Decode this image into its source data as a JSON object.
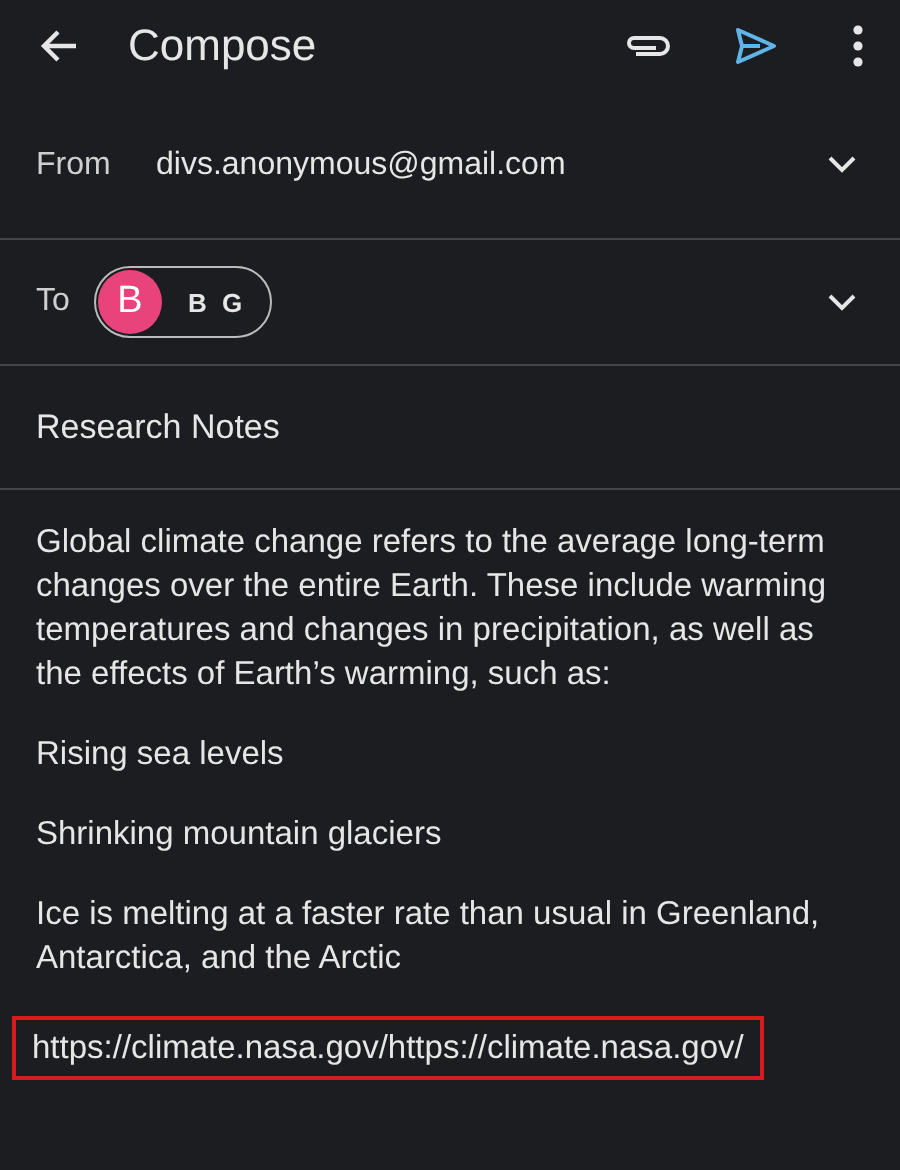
{
  "app_bar": {
    "title": "Compose"
  },
  "from": {
    "label": "From",
    "value": "divs.anonymous@gmail.com"
  },
  "to": {
    "label": "To",
    "recipients": [
      {
        "initial": "B",
        "name": "B G",
        "color": "#e8437a"
      }
    ]
  },
  "subject": {
    "value": "Research Notes"
  },
  "body": [
    {
      "text": "Global climate change refers to the average long-term changes over the entire Earth. These include warming temperatures and changes in precipitation, as well as the effects of Earth’s warming, such as:",
      "highlighted": false
    },
    {
      "text": "Rising sea levels",
      "highlighted": false
    },
    {
      "text": "Shrinking mountain glaciers",
      "highlighted": false
    },
    {
      "text": "Ice is melting at a faster rate than usual in Greenland, Antarctica, and the Arctic",
      "highlighted": false
    },
    {
      "text": "https://climate.nasa.gov/https://climate.nasa.gov/",
      "highlighted": true
    }
  ]
}
